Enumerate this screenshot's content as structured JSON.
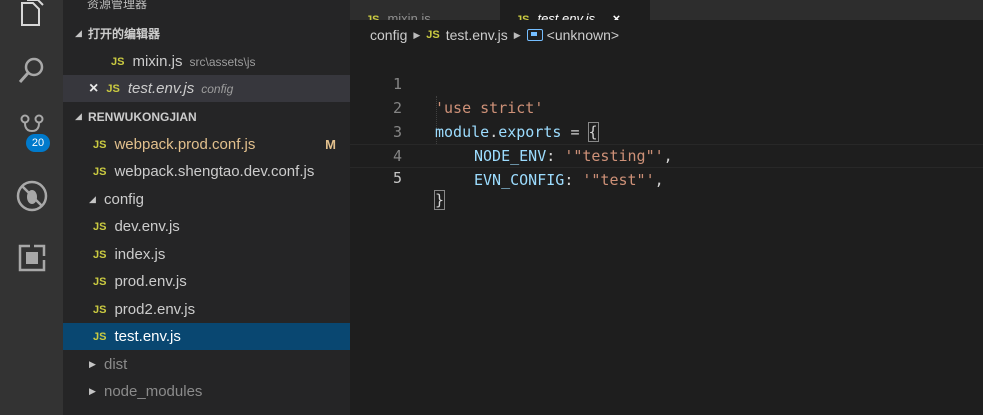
{
  "sidebar": {
    "top_partial_label": "资源管理器",
    "open_editors_header": "打开的编辑器",
    "open_editors": [
      {
        "name": "mixin.js",
        "desc": "src\\assets\\js"
      },
      {
        "name": "test.env.js",
        "desc": "config",
        "close": "×"
      }
    ],
    "project_header": "RENWUKONGJIAN",
    "files": [
      {
        "name": "webpack.prod.conf.js",
        "badge": "M"
      },
      {
        "name": "webpack.shengtao.dev.conf.js"
      }
    ],
    "config_folder": "config",
    "config_files": [
      "dev.env.js",
      "index.js",
      "prod.env.js",
      "prod2.env.js",
      "test.env.js"
    ],
    "folders_collapsed": [
      "dist",
      "node_modules"
    ],
    "js_label": "JS"
  },
  "activity": {
    "scm_badge": "20",
    "icons": [
      "files-icon",
      "search-icon",
      "source-control-icon",
      "debug-icon",
      "extensions-icon"
    ]
  },
  "tabs": {
    "items": [
      {
        "label": "mixin.js"
      },
      {
        "label": "test.env.js",
        "close": "×"
      }
    ]
  },
  "breadcrumb": {
    "folder": "config",
    "file": "test.env.js",
    "symbol": "<unknown>"
  },
  "editor": {
    "line_numbers": [
      "1",
      "2",
      "3",
      "4",
      "5"
    ],
    "line1": "'use strict'",
    "line2_a": "module",
    "line2_b": ".",
    "line2_c": "exports",
    "line2_d": " = ",
    "line2_e": "{",
    "line3_key": "NODE_ENV",
    "line3_colon": ": ",
    "line3_val": "'\"testing\"'",
    "line3_comma": ",",
    "line4_key": "EVN_CONFIG",
    "line4_colon": ": ",
    "line4_val": "'\"test\"'",
    "line4_comma": ",",
    "line5": "}"
  },
  "colors": {
    "accent": "#007acc",
    "selection": "#094771",
    "js_icon": "#cbcb41",
    "modified": "#e2c08d"
  }
}
